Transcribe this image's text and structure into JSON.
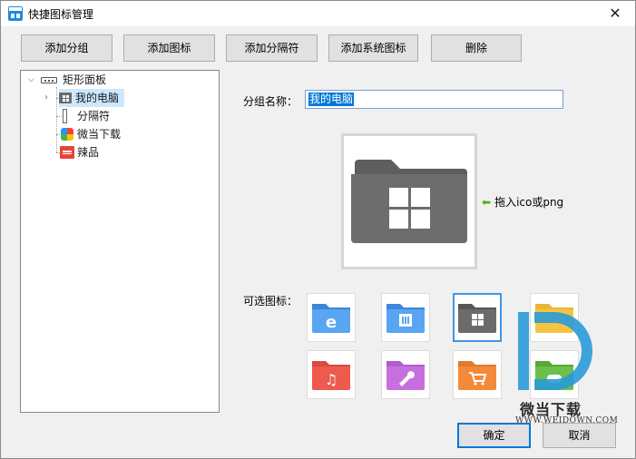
{
  "window": {
    "title": "快捷图标管理",
    "close_glyph": "✕"
  },
  "toolbar": {
    "buttons": [
      "添加分组",
      "添加图标",
      "添加分隔符",
      "添加系统图标",
      "删除"
    ]
  },
  "tree": {
    "root": {
      "label": "矩形面板",
      "expanded": true
    },
    "children": [
      {
        "label": "我的电脑",
        "icon": "folder-computer-icon",
        "selected": true,
        "has_children": true
      },
      {
        "label": "分隔符",
        "icon": "separator-icon"
      },
      {
        "label": "微当下载",
        "icon": "app-icon"
      },
      {
        "label": "辣品",
        "icon": "app-icon-red"
      }
    ]
  },
  "form": {
    "group_name_label": "分组名称：",
    "group_name_value": "我的电脑",
    "drag_hint": "拖入ico或png",
    "available_icons_label": "可选图标："
  },
  "icon_options": [
    {
      "name": "ie",
      "color": "#4d9cf0",
      "selected": false
    },
    {
      "name": "apps",
      "color": "#4d9cf0",
      "selected": false
    },
    {
      "name": "windows",
      "color": "#6b6b6b",
      "selected": true
    },
    {
      "name": "yellow",
      "color": "#f5c542",
      "selected": false
    },
    {
      "name": "music",
      "color": "#ef5a4e",
      "selected": false
    },
    {
      "name": "tools",
      "color": "#c86fe0",
      "selected": false
    },
    {
      "name": "shop",
      "color": "#f5893a",
      "selected": false
    },
    {
      "name": "game",
      "color": "#6cc04a",
      "selected": false
    }
  ],
  "dialog": {
    "ok_label": "确定",
    "cancel_label": "取消"
  },
  "watermark": {
    "name": "微当下载",
    "url": "WWW.WEIDOWN.COM"
  },
  "colors": {
    "accent": "#0078d7",
    "selection": "#cce8ff",
    "hint_arrow": "#52b012"
  }
}
